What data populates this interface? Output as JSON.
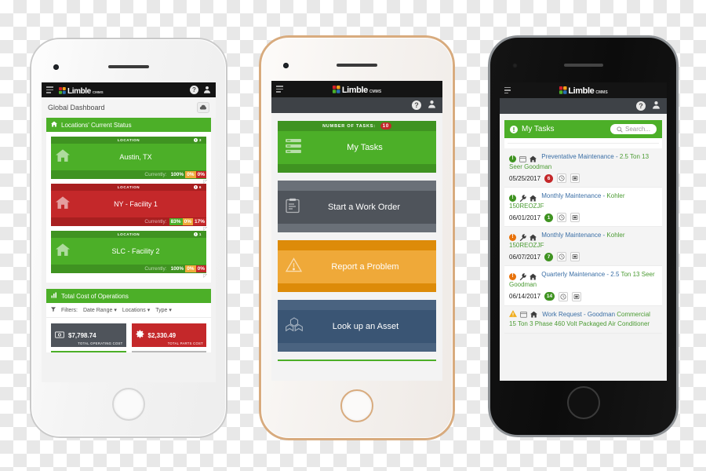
{
  "brand": {
    "name": "Limble",
    "suffix": "CMMS",
    "logo_icon": "limble-puzzle-logo"
  },
  "nav": {
    "menu_icon": "hamburger-menu-icon",
    "help_icon": "help-question-icon",
    "help_label": "?",
    "user_icon": "user-avatar-icon"
  },
  "phone1": {
    "frame": "white-silver",
    "page_title": "Global Dashboard",
    "cloud_icon": "cloud-download-icon",
    "locations_panel": {
      "icon": "home-icon",
      "title": "Locations' Current Status",
      "column_label": "LOCATION",
      "cards": [
        {
          "status": "green",
          "name": "Austin, TX",
          "count_icon": "alert-circle-icon",
          "count": "3",
          "currently_label": "Currently:",
          "segments": [
            {
              "value": "100%",
              "color": "#3f9321"
            },
            {
              "value": "0%",
              "color": "#efa939"
            },
            {
              "value": "0%",
              "color": "#c4282a"
            }
          ]
        },
        {
          "status": "red",
          "name": "NY - Facility 1",
          "count_icon": "alert-circle-icon",
          "count": "6",
          "currently_label": "Currently:",
          "segments": [
            {
              "value": "83%",
              "color": "#4caf28"
            },
            {
              "value": "0%",
              "color": "#efa939"
            },
            {
              "value": "17%",
              "color": "#c4282a"
            }
          ]
        },
        {
          "status": "green",
          "name": "SLC - Facility 2",
          "count_icon": "alert-circle-icon",
          "count": "1",
          "currently_label": "Currently:",
          "segments": [
            {
              "value": "100%",
              "color": "#3f9321"
            },
            {
              "value": "0%",
              "color": "#efa939"
            },
            {
              "value": "0%",
              "color": "#c4282a"
            }
          ]
        }
      ]
    },
    "cost_panel": {
      "icon": "bar-chart-icon",
      "title": "Total Cost of Operations",
      "filter_icon": "funnel-filter-icon",
      "filters_label": "Filters:",
      "filters": [
        "Date Range",
        "Locations",
        "Type"
      ],
      "cards": [
        {
          "icon": "money-bill-icon",
          "value": "$7,798.74",
          "label": "TOTAL OPERATING COST",
          "box_color": "#4f545b",
          "rule_color": "#4caf28"
        },
        {
          "icon": "gear-icon",
          "value": "$2,330.49",
          "label": "TOTAL PARTS COST",
          "box_color": "#c4282a",
          "rule_color": "#b9b9b9"
        }
      ]
    }
  },
  "phone2": {
    "frame": "gold",
    "actions": [
      {
        "theme": "green",
        "top_label": "NUMBER OF TASKS:",
        "badge": "10",
        "label": "My Tasks",
        "icon": "task-list-icon"
      },
      {
        "theme": "slate",
        "top_label": "",
        "badge": "",
        "label": "Start a Work Order",
        "icon": "clipboard-icon"
      },
      {
        "theme": "orange",
        "top_label": "",
        "badge": "",
        "label": "Report a Problem",
        "icon": "warning-triangle-icon"
      },
      {
        "theme": "navy",
        "top_label": "",
        "badge": "",
        "label": "Look up an Asset",
        "icon": "boxes-cubes-icon"
      }
    ]
  },
  "phone3": {
    "frame": "black",
    "tasks_panel": {
      "icon": "alert-circle-icon",
      "title": "My Tasks",
      "search_icon": "search-icon",
      "search_placeholder": "Search..."
    },
    "tasks": [
      {
        "priority_icon": "alert-circle-icon",
        "priority_color": "green",
        "type_icon": "calendar-icon",
        "location_icon": "home-icon",
        "title": "Preventative Maintenance -",
        "subtitle": "2.5 Ton 13 Seer Goodman",
        "date": "05/25/2017",
        "count": "6",
        "count_color": "red",
        "clock_icon": "clock-icon",
        "note_icon": "note-square-icon",
        "shaded": true
      },
      {
        "priority_icon": "alert-circle-icon",
        "priority_color": "green",
        "type_icon": "wrench-icon",
        "location_icon": "home-icon",
        "title": "Monthly Maintenance -",
        "subtitle": "Kohler 150REOZJF",
        "date": "06/01/2017",
        "count": "1",
        "count_color": "green",
        "clock_icon": "clock-icon",
        "note_icon": "note-square-icon",
        "shaded": false
      },
      {
        "priority_icon": "alert-circle-icon",
        "priority_color": "orange",
        "type_icon": "wrench-icon",
        "location_icon": "home-icon",
        "title": "Monthly Maintenance -",
        "subtitle": "Kohler 150REOZJF",
        "date": "06/07/2017",
        "count": "7",
        "count_color": "green",
        "clock_icon": "clock-icon",
        "note_icon": "note-square-icon",
        "shaded": true
      },
      {
        "priority_icon": "alert-circle-icon",
        "priority_color": "orange",
        "type_icon": "wrench-icon",
        "location_icon": "home-icon",
        "title": "Quarterly Maintenance - 2.5",
        "subtitle": "Ton 13 Seer Goodman",
        "date": "06/14/2017",
        "count": "14",
        "count_color": "green",
        "clock_icon": "clock-icon",
        "note_icon": "note-square-icon",
        "shaded": false
      },
      {
        "priority_icon": "warning-triangle-icon",
        "priority_color": "warning",
        "type_icon": "calendar-icon",
        "location_icon": "home-icon",
        "title": "Work Request - Goodman",
        "subtitle": "Commercial 15 Ton 3 Phase 460 Volt Packaged Air Conditioner",
        "date": "",
        "count": "",
        "count_color": "",
        "clock_icon": "",
        "note_icon": "",
        "shaded": true
      }
    ]
  },
  "colors": {
    "green": "#4caf28",
    "green_dark": "#3f9321",
    "red": "#c4282a",
    "orange": "#efa939",
    "slate": "#4f545b",
    "navy": "#3a5574",
    "nav_black": "#141414",
    "subbar": "#3e4247",
    "link_blue": "#3a6ea5"
  }
}
